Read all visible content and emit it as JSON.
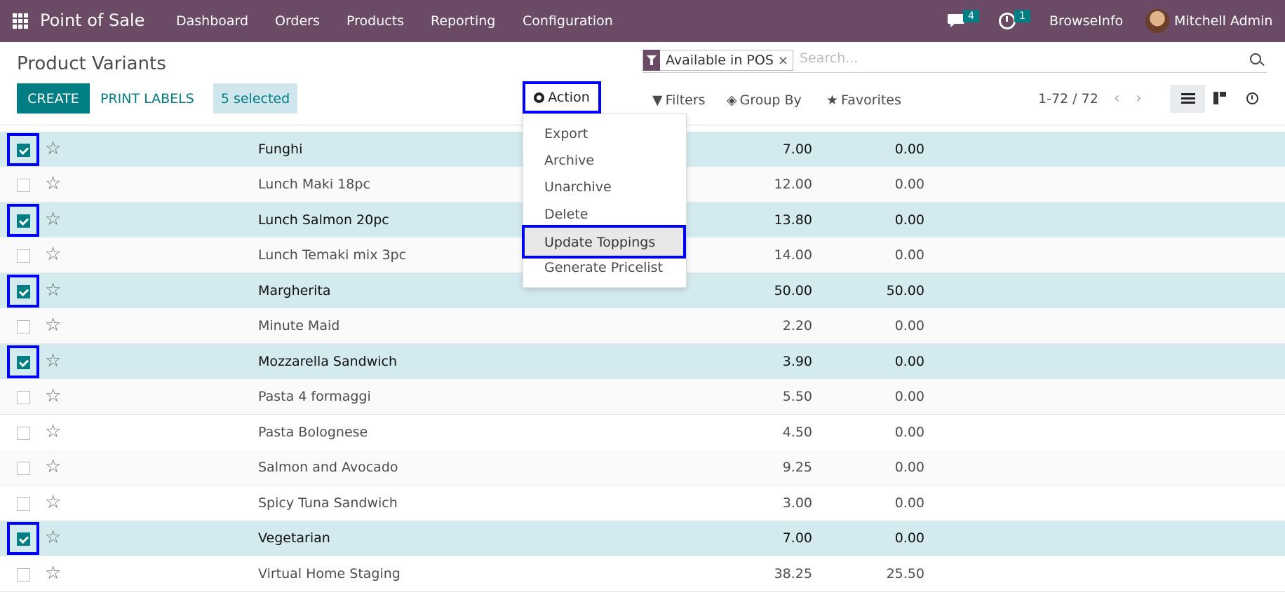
{
  "navbar": {
    "app_name": "Point of Sale",
    "menu": [
      "Dashboard",
      "Orders",
      "Products",
      "Reporting",
      "Configuration"
    ],
    "messages_count": "4",
    "activities_count": "1",
    "company": "BrowseInfo",
    "user": "Mitchell Admin",
    "icons": [
      "apps-grid-icon",
      "chat-icon",
      "clock-icon"
    ]
  },
  "page": {
    "title": "Product Variants"
  },
  "search": {
    "facet_label": "Available in POS",
    "facet_remove": "×",
    "placeholder": "Search..."
  },
  "buttons": {
    "create": "CREATE",
    "print_labels": "PRINT LABELS",
    "selected": "5 selected",
    "action": "Action"
  },
  "controls": {
    "filters": "Filters",
    "group_by": "Group By",
    "favorites": "Favorites",
    "pager": "1-72 / 72",
    "prev": "‹",
    "next": "›"
  },
  "action_menu": {
    "items": [
      "Export",
      "Archive",
      "Unarchive",
      "Delete",
      "Update Toppings",
      "Generate Pricelist"
    ],
    "highlighted": "Update Toppings"
  },
  "rows": [
    {
      "name": "Funghi",
      "price": "7.00",
      "cost": "0.00",
      "selected": true
    },
    {
      "name": "Lunch Maki 18pc",
      "price": "12.00",
      "cost": "0.00",
      "selected": false
    },
    {
      "name": "Lunch Salmon 20pc",
      "price": "13.80",
      "cost": "0.00",
      "selected": true
    },
    {
      "name": "Lunch Temaki mix 3pc",
      "price": "14.00",
      "cost": "0.00",
      "selected": false
    },
    {
      "name": "Margherita",
      "price": "50.00",
      "cost": "50.00",
      "selected": true
    },
    {
      "name": "Minute Maid",
      "price": "2.20",
      "cost": "0.00",
      "selected": false
    },
    {
      "name": "Mozzarella Sandwich",
      "price": "3.90",
      "cost": "0.00",
      "selected": true
    },
    {
      "name": "Pasta 4 formaggi",
      "price": "5.50",
      "cost": "0.00",
      "selected": false
    },
    {
      "name": "Pasta Bolognese",
      "price": "4.50",
      "cost": "0.00",
      "selected": false
    },
    {
      "name": "Salmon and Avocado",
      "price": "9.25",
      "cost": "0.00",
      "selected": false
    },
    {
      "name": "Spicy Tuna Sandwich",
      "price": "3.00",
      "cost": "0.00",
      "selected": false
    },
    {
      "name": "Vegetarian",
      "price": "7.00",
      "cost": "0.00",
      "selected": true
    },
    {
      "name": "Virtual Home Staging",
      "price": "38.25",
      "cost": "25.50",
      "selected": false
    }
  ],
  "colors": {
    "navbar": "#6b4a66",
    "primary": "#017e84",
    "selected_row": "#d3eaef",
    "highlight_box": "#0000ff"
  }
}
